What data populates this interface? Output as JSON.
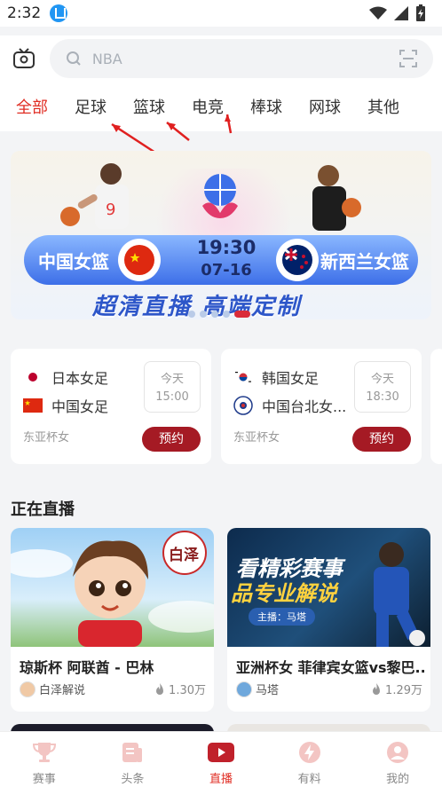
{
  "status": {
    "time": "2:32"
  },
  "search": {
    "placeholder": "NBA"
  },
  "tabs": [
    {
      "label": "全部",
      "active": true
    },
    {
      "label": "足球",
      "active": false
    },
    {
      "label": "篮球",
      "active": false
    },
    {
      "label": "电竞",
      "active": false
    },
    {
      "label": "棒球",
      "active": false
    },
    {
      "label": "网球",
      "active": false
    },
    {
      "label": "其他",
      "active": false
    }
  ],
  "banner": {
    "home_team": "中国女篮",
    "away_team": "新西兰女篮",
    "time": "19:30",
    "date": "07-16",
    "slogan": "超清直播 高端定制",
    "slide_count": 5,
    "active_slide": 5
  },
  "matches": [
    {
      "team1": "日本女足",
      "team2": "中国女足",
      "day": "今天",
      "time": "15:00",
      "league": "东亚杯女",
      "action": "预约"
    },
    {
      "team1": "韩国女足",
      "team2": "中国台北女...",
      "day": "今天",
      "time": "18:30",
      "league": "东亚杯女",
      "action": "预约"
    }
  ],
  "live": {
    "section_title": "正在直播",
    "items": [
      {
        "title": "琼斯杯 阿联酋 - 巴林",
        "streamer": "白泽解说",
        "heat": "1.30万",
        "badge": "白泽"
      },
      {
        "title": "亚洲杯女 菲律宾女篮vs黎巴...",
        "streamer": "马塔",
        "heat": "1.29万",
        "overlay1": "看精彩赛事",
        "overlay2": "品专业解说",
        "overlay3": "主播：马塔"
      }
    ]
  },
  "nav": [
    {
      "label": "赛事",
      "icon": "trophy-icon",
      "active": false
    },
    {
      "label": "头条",
      "icon": "news-icon",
      "active": false
    },
    {
      "label": "直播",
      "icon": "play-icon",
      "active": true
    },
    {
      "label": "有料",
      "icon": "bolt-icon",
      "active": false
    },
    {
      "label": "我的",
      "icon": "profile-icon",
      "active": false
    }
  ],
  "colors": {
    "accent": "#e02e24",
    "button": "#a51a24",
    "banner_blue": "#3d6fe8"
  }
}
